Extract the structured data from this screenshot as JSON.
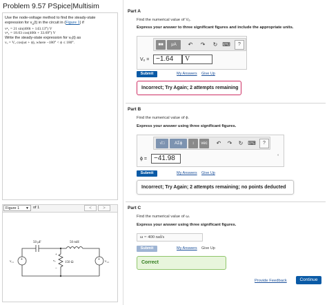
{
  "page": {
    "title": "Problem 9.57 PSpice|Multisim"
  },
  "problem": {
    "lines": [
      "Use the node-voltage method to find the steady-state",
      "expression for vₒ(t) in the circuit in (Figure 1) if",
      "vᵍ₁ = 21 sin(400t + 143.13°) V",
      "vᵍ₂ = 18.03 cos(400t + 33.69°) V",
      "Write the steady-state expression for vₒ(t) as",
      "vₒ = Vₒ cos(ωt + ϕ), where −180° < ϕ ≤ 180°."
    ],
    "figure_link": "Figure 1"
  },
  "figure": {
    "select_value": "Figure 1",
    "of_text": "of 1",
    "prev": "<",
    "next": ">",
    "circuit": {
      "cap_label": "50 μF",
      "ind_label": "50 mH",
      "res_label": "150 Ω",
      "src_left": "v₁₁",
      "src_right": "v₁₂",
      "plus": "+",
      "minus": "−",
      "vo": "vₒ"
    }
  },
  "partA": {
    "label": "Part A",
    "question": "Find the numerical value of Vₒ.",
    "instruction": "Express your answer to three significant figures and include the appropriate units.",
    "toolbar": [
      "■■",
      "μA",
      "↶",
      "↷",
      "↻",
      "⌨",
      "?"
    ],
    "answer_label": "Vₒ =",
    "answer_value": "−1.64",
    "answer_unit": "V",
    "submit": "Submit",
    "my_answers": "My Answers",
    "give_up": "Give Up",
    "feedback": "Incorrect; Try Again; 2 attempts remaining"
  },
  "partB": {
    "label": "Part B",
    "question": "Find the numerical value of ϕ.",
    "instruction": "Express your answer using three significant figures.",
    "toolbar": [
      "√□",
      "AΣϕ",
      "↕",
      "vec",
      "↶",
      "↷",
      "↻",
      "⌨",
      "?"
    ],
    "answer_label": "ϕ =",
    "answer_value": "−41.98",
    "degree_mark": "°",
    "submit": "Submit",
    "my_answers": "My Answers",
    "give_up": "Give Up",
    "feedback": "Incorrect; Try Again; 2 attempts remaining; no points deducted"
  },
  "partC": {
    "label": "Part C",
    "question": "Find the numerical value of ω.",
    "instruction": "Express your answer using three significant figures.",
    "answer_text": "ω =  400    rad/s",
    "submit": "Submit",
    "my_answers": "My Answers",
    "give_up": "Give Up",
    "feedback": "Correct"
  },
  "footer": {
    "provide_feedback": "Provide Feedback",
    "continue": "Continue"
  },
  "colors": {
    "accent": "#0a5aa6",
    "incorrect_border": "#cd2d63",
    "correct_bg": "#e8f5dc",
    "correct_text": "#2f7a1b"
  }
}
